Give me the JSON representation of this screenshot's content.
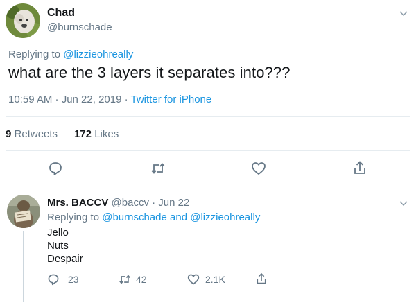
{
  "main_tweet": {
    "author": {
      "name": "Chad",
      "handle": "@burnschade",
      "avatar_icon": "dog-avatar"
    },
    "replying_prefix": "Replying to",
    "replying_to": "@lizzieohreally",
    "text": "what are the 3 layers it separates into???",
    "timestamp": "10:59 AM · Jun 22, 2019 · ",
    "source": "Twitter for iPhone",
    "stats": {
      "retweets_count": "9",
      "retweets_label": "Retweets",
      "likes_count": "172",
      "likes_label": "Likes"
    }
  },
  "reply": {
    "author": {
      "name": "Mrs. BACCV",
      "handle": "@baccv",
      "date": "· Jun 22",
      "avatar_icon": "animal-with-sign-avatar"
    },
    "replying_prefix": "Replying to",
    "replying_to_1": "@burnschade",
    "and_word": "and",
    "replying_to_2": "@lizzieohreally",
    "lines": [
      "Jello",
      "Nuts",
      "Despair"
    ],
    "counts": {
      "replies": "23",
      "retweets": "42",
      "likes": "2.1K"
    }
  },
  "colors": {
    "link": "#1b95e0",
    "muted": "#657786",
    "divider": "#e6ecf0"
  }
}
